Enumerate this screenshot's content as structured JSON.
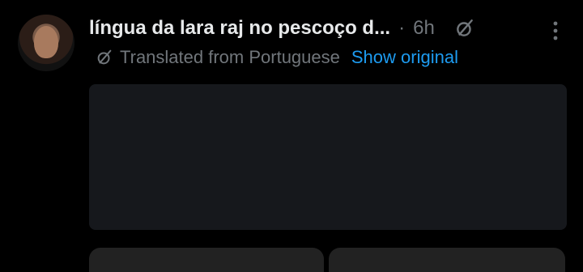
{
  "post": {
    "author_name": "língua da lara raj no pescoço d...",
    "separator": "·",
    "time": "6h",
    "translation_note": "Translated from Portuguese",
    "show_original_label": "Show original"
  },
  "icons": {
    "grok": "grok-icon",
    "more": "more-icon",
    "translate": "translate-icon"
  },
  "colors": {
    "background": "#000000",
    "text": "#e7e9ea",
    "muted": "#71767b",
    "link": "#1d9bf0"
  }
}
